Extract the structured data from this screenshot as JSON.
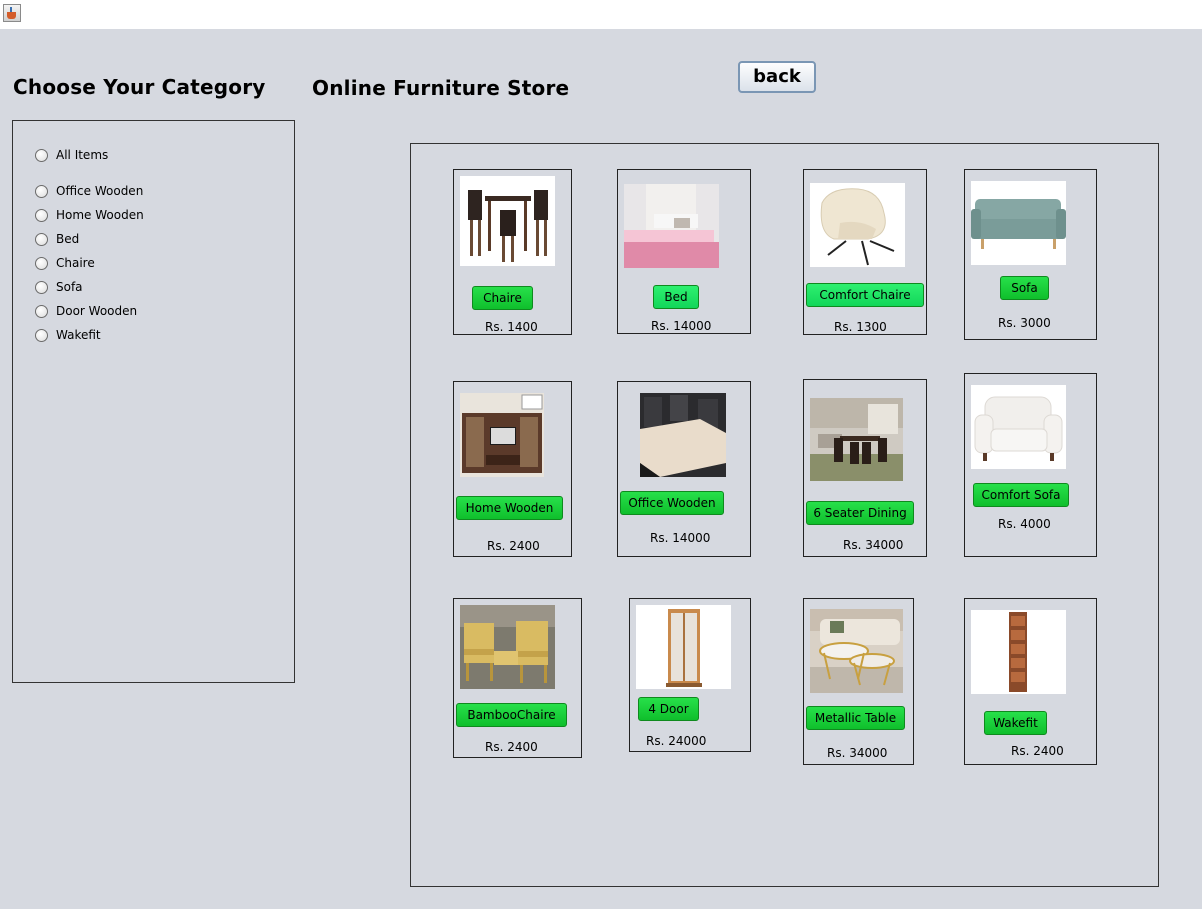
{
  "window": {
    "icon": "java-cup-icon"
  },
  "sidebar": {
    "heading": "Choose Your Category",
    "categories": [
      {
        "label": "All Items"
      },
      {
        "label": "Office Wooden"
      },
      {
        "label": "Home Wooden"
      },
      {
        "label": "Bed"
      },
      {
        "label": "Chaire"
      },
      {
        "label": "Sofa"
      },
      {
        "label": "Door Wooden"
      },
      {
        "label": "Wakefit"
      }
    ]
  },
  "header": {
    "title": "Online Furniture Store",
    "back_label": "back"
  },
  "accent_colors": {
    "button_green": "#1dd13a",
    "button_border": "#0f8a1e",
    "background": "#d6d9e0"
  },
  "products": [
    {
      "name": "Chaire",
      "price": "Rs. 1400",
      "image": "dining-set-image"
    },
    {
      "name": "Bed",
      "price": "Rs. 14000",
      "image": "bed-image"
    },
    {
      "name": "Comfort Chaire",
      "price": "Rs. 1300",
      "image": "lounge-chair-image"
    },
    {
      "name": "Sofa",
      "price": "Rs. 3000",
      "image": "teal-sofa-image"
    },
    {
      "name": "Home Wooden",
      "price": "Rs. 2400",
      "image": "tv-unit-image"
    },
    {
      "name": "Office Wooden",
      "price": "Rs. 14000",
      "image": "office-table-image"
    },
    {
      "name": "6 Seater Dining",
      "price": "Rs. 34000",
      "image": "dining-room-image"
    },
    {
      "name": "Comfort Sofa",
      "price": "Rs. 4000",
      "image": "armchair-image"
    },
    {
      "name": "BambooChaire",
      "price": "Rs. 2400",
      "image": "bamboo-set-image"
    },
    {
      "name": "4 Door",
      "price": "Rs. 24000",
      "image": "wardrobe-image"
    },
    {
      "name": "Metallic Table",
      "price": "Rs. 34000",
      "image": "nesting-table-image"
    },
    {
      "name": "Wakefit",
      "price": "Rs. 2400",
      "image": "corner-shelf-image"
    }
  ]
}
